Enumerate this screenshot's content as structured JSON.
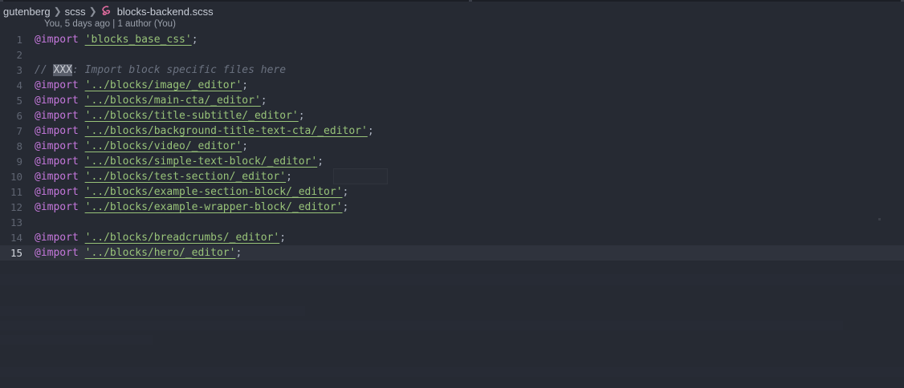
{
  "breadcrumb": {
    "folder1": "gutenberg",
    "folder2": "scss",
    "file": "blocks-backend.scss",
    "file_icon": "sass-icon"
  },
  "blame": {
    "text": "You, 5 days ago | 1 author (You)"
  },
  "colors": {
    "background": "#262a33",
    "keyword": "#c678dd",
    "string": "#98c379",
    "comment": "#6b7280",
    "line_number": "#5f6572",
    "current_line": "#2f333d"
  },
  "editor": {
    "current_line": 15,
    "lines": [
      {
        "n": "1",
        "type": "import",
        "kw": "@import",
        "str": "'blocks_base_css'",
        "end": ";"
      },
      {
        "n": "2",
        "type": "empty"
      },
      {
        "n": "3",
        "type": "comment",
        "prefix": "// ",
        "highlight": "XXX",
        "rest": ": Import block specific files here"
      },
      {
        "n": "4",
        "type": "import",
        "kw": "@import",
        "str": "'../blocks/image/_editor'",
        "end": ";"
      },
      {
        "n": "5",
        "type": "import",
        "kw": "@import",
        "str": "'../blocks/main-cta/_editor'",
        "end": ";"
      },
      {
        "n": "6",
        "type": "import",
        "kw": "@import",
        "str": "'../blocks/title-subtitle/_editor'",
        "end": ";"
      },
      {
        "n": "7",
        "type": "import",
        "kw": "@import",
        "str": "'../blocks/background-title-text-cta/_editor'",
        "end": ";"
      },
      {
        "n": "8",
        "type": "import",
        "kw": "@import",
        "str": "'../blocks/video/_editor'",
        "end": ";"
      },
      {
        "n": "9",
        "type": "import",
        "kw": "@import",
        "str": "'../blocks/simple-text-block/_editor'",
        "end": ";"
      },
      {
        "n": "10",
        "type": "import",
        "kw": "@import",
        "str": "'../blocks/test-section/_editor'",
        "end": ";"
      },
      {
        "n": "11",
        "type": "import",
        "kw": "@import",
        "str": "'../blocks/example-section-block/_editor'",
        "end": ";"
      },
      {
        "n": "12",
        "type": "import",
        "kw": "@import",
        "str": "'../blocks/example-wrapper-block/_editor'",
        "end": ";"
      },
      {
        "n": "13",
        "type": "empty"
      },
      {
        "n": "14",
        "type": "import",
        "kw": "@import",
        "str": "'../blocks/breadcrumbs/_editor'",
        "end": ";"
      },
      {
        "n": "15",
        "type": "import",
        "kw": "@import",
        "str": "'../blocks/hero/_editor'",
        "end": ";"
      }
    ]
  }
}
